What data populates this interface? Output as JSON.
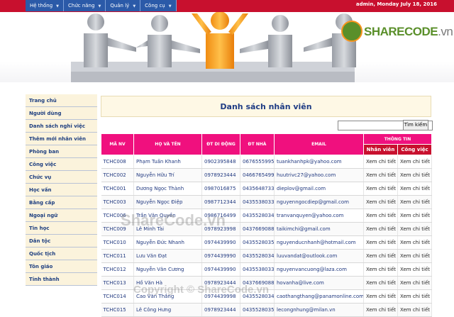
{
  "menu": [
    {
      "label": "Hệ thống"
    },
    {
      "label": "Chức năng"
    },
    {
      "label": "Quản lý"
    },
    {
      "label": "Công cụ"
    }
  ],
  "header": {
    "info": "admin, Monday July 18, 2016"
  },
  "brand": {
    "name": "SHARECODE",
    "suffix": ".vn"
  },
  "sidebar": {
    "items": [
      {
        "label": "Trang chủ"
      },
      {
        "label": "Người dùng"
      },
      {
        "label": "Danh sách nghỉ việc"
      },
      {
        "label": "Thêm mới nhân viên"
      },
      {
        "label": "Phòng ban"
      },
      {
        "label": "Công việc"
      },
      {
        "label": "Chức vụ"
      },
      {
        "label": "Học vấn"
      },
      {
        "label": "Bằng cấp"
      },
      {
        "label": "Ngoại ngữ"
      },
      {
        "label": "Tin học"
      },
      {
        "label": "Dân tộc"
      },
      {
        "label": "Quốc tịch"
      },
      {
        "label": "Tôn giáo"
      },
      {
        "label": "Tỉnh thành"
      }
    ]
  },
  "main": {
    "title": "Danh sách nhân viên",
    "search_button": "Tìm kiếm",
    "search_value": ""
  },
  "table": {
    "headers": {
      "id": "MÃ NV",
      "name": "HỌ VÀ TÊN",
      "mobile": "ĐT DI ĐỘNG",
      "home": "ĐT NHÀ",
      "email": "EMAIL",
      "info": "THÔNG TIN",
      "sub1": "Nhân viên",
      "sub2": "Công việc"
    },
    "rows": [
      {
        "id": "TCHC008",
        "name": "Phạm Tuấn Khanh",
        "mobile": "0902395848",
        "home": "0676555995",
        "email": "tuankhanhpk@yahoo.com",
        "a": "Xem chi tiết",
        "b": "Xem chi tiết"
      },
      {
        "id": "TCHC002",
        "name": "Nguyễn Hữu Trí",
        "mobile": "0978923444",
        "home": "0466765499",
        "email": "huutrivc27@yahoo.com",
        "a": "Xem chi tiết",
        "b": "Xem chi tiết"
      },
      {
        "id": "TCHC001",
        "name": "Dương Ngọc Thành",
        "mobile": "0987016875",
        "home": "0435648733",
        "email": "dieplov@gmail.com",
        "a": "Xem chi tiết",
        "b": "Xem chi tiết"
      },
      {
        "id": "TCHC003",
        "name": "Nguyễn Ngọc Điệp",
        "mobile": "0987712344",
        "home": "0435538033",
        "email": "nguyenngocdiep@gmail.com",
        "a": "Xem chi tiết",
        "b": "Xem chi tiết"
      },
      {
        "id": "TCHC006",
        "name": "Trần Văn Quyền",
        "mobile": "0986716499",
        "home": "0435528034",
        "email": "tranvanquyen@yahoo.com",
        "a": "Xem chi tiết",
        "b": "Xem chi tiết"
      },
      {
        "id": "TCHC009",
        "name": "Lê Minh Tài",
        "mobile": "0978923998",
        "home": "0437669088",
        "email": "taikimchi@gmail.com",
        "a": "Xem chi tiết",
        "b": "Xem chi tiết"
      },
      {
        "id": "TCHC010",
        "name": "Nguyễn Đức Nhanh",
        "mobile": "0974439990",
        "home": "0435528035",
        "email": "nguyenducnhanh@hotmail.com",
        "a": "Xem chi tiết",
        "b": "Xem chi tiết"
      },
      {
        "id": "TCHC011",
        "name": "Lưu Văn Đạt",
        "mobile": "0974439990",
        "home": "0435528034",
        "email": "luuvandat@outlook.com",
        "a": "Xem chi tiết",
        "b": "Xem chi tiết"
      },
      {
        "id": "TCHC012",
        "name": "Nguyễn Văn Cương",
        "mobile": "0974439990",
        "home": "0435538033",
        "email": "nguyenvancuong@laza.com",
        "a": "Xem chi tiết",
        "b": "Xem chi tiết"
      },
      {
        "id": "TCHC013",
        "name": "Hồ Văn Hà",
        "mobile": "0978923444",
        "home": "0437669088",
        "email": "hovanha@live.com",
        "a": "Xem chi tiết",
        "b": "Xem chi tiết"
      },
      {
        "id": "TCHC014",
        "name": "Cao Văn Thắng",
        "mobile": "0974439998",
        "home": "0435528034",
        "email": "caothangthang@panamonline.com",
        "a": "Xem chi tiết",
        "b": "Xem chi tiết"
      },
      {
        "id": "TCHC015",
        "name": "Lê Công Hưng",
        "mobile": "0978923444",
        "home": "0435528035",
        "email": "lecongnhung@milan.vn",
        "a": "Xem chi tiết",
        "b": "Xem chi tiết"
      }
    ]
  },
  "watermark": {
    "center": "ShareCode.vn",
    "bottom": "Copyright © ShareCode.vn"
  },
  "colors": {
    "menu": "#2b5aa8",
    "topbar": "#c8102e",
    "header_row": "#f0107e",
    "sidebar_bg": "#fbf3dc",
    "title_bg": "#fef8e5",
    "brand_green": "#5a8f2a"
  }
}
